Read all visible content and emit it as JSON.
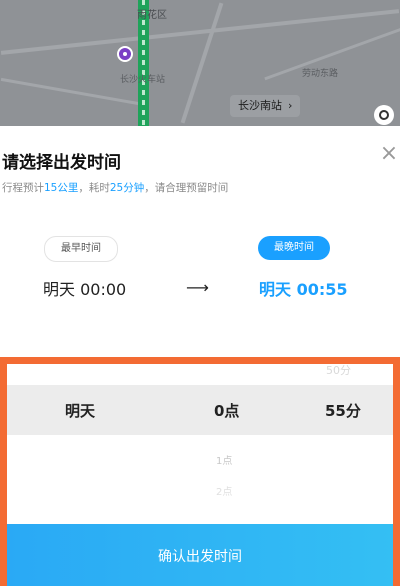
{
  "map": {
    "district_label": "雨花区",
    "poi_label": "长沙火车站",
    "road_label": "劳动东路",
    "station_button": "长沙南站",
    "chevron_icon": "chevron-right-icon",
    "locate_icon": "locate-icon"
  },
  "sheet": {
    "title": "请选择出发时间",
    "close_icon": "close-icon",
    "subtitle": {
      "prefix": "行程预计",
      "distance": "15公里",
      "middle": "，耗时",
      "duration": "25分钟",
      "suffix": "，请合理预留时间"
    },
    "earliest": {
      "label": "最早时间",
      "time": "明天 00:00"
    },
    "latest": {
      "label": "最晚时间",
      "time": "明天 00:55"
    },
    "arrow": "⟶"
  },
  "picker": {
    "above_min": "50分",
    "selected_day": "明天",
    "selected_hour": "0点",
    "selected_minute": "55分",
    "below_hour_1": "1点",
    "below_hour_2": "2点"
  },
  "confirm_label": "确认出发时间",
  "colors": {
    "accent": "#1aa0ff",
    "highlight_frame": "#f36b33",
    "route": "#1fa35a"
  }
}
